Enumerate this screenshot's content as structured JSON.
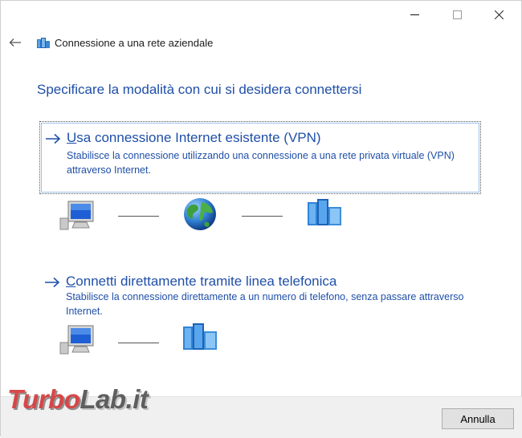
{
  "window": {
    "title": "Connessione a una rete aziendale",
    "controls": [
      "minimize",
      "maximize",
      "close"
    ]
  },
  "header": {
    "back_icon": "arrow-left-icon",
    "wizard_icon": "network-workplace-icon"
  },
  "main": {
    "heading": "Specificare la modalità con cui si desidera connettersi",
    "options": [
      {
        "access_key": "U",
        "title_rest": "sa connessione Internet esistente (VPN)",
        "description": "Stabilisce la connessione utilizzando una connessione a una rete privata virtuale (VPN) attraverso Internet.",
        "diagram": [
          "computer-icon",
          "globe-icon",
          "server-icon"
        ]
      },
      {
        "access_key": "C",
        "title_rest": "onnetti direttamente tramite linea telefonica",
        "description": "Stabilisce la connessione direttamente a un numero di telefono, senza passare attraverso Internet.",
        "diagram": [
          "computer-icon",
          "server-icon"
        ]
      }
    ]
  },
  "footer": {
    "cancel_label": "Annulla"
  },
  "watermark": {
    "part1": "Turbo",
    "part2": "Lab.it"
  },
  "colors": {
    "link_blue": "#1f4fa8",
    "footer_bg": "#f0f0f0",
    "watermark_red": "#cf1d1d"
  }
}
